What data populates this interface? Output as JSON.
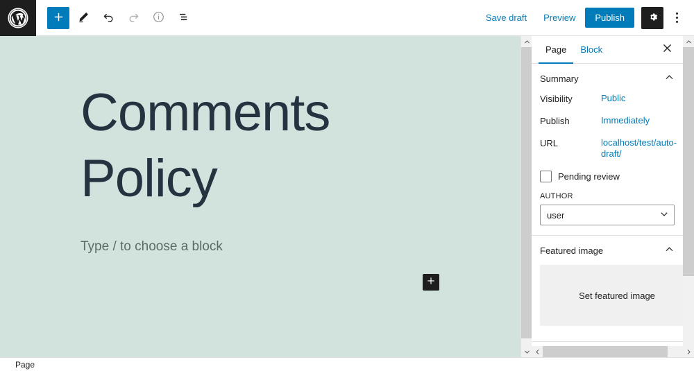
{
  "topbar": {
    "logo_icon": "wordpress-logo-icon",
    "tools": [
      {
        "name": "block-inserter-button",
        "icon": "plus-icon",
        "state": "primary"
      },
      {
        "name": "tools-edit-button",
        "icon": "pencil-icon",
        "state": "default"
      },
      {
        "name": "undo-button",
        "icon": "undo-arrow-icon",
        "state": "default"
      },
      {
        "name": "redo-button",
        "icon": "redo-arrow-icon",
        "state": "disabled"
      },
      {
        "name": "details-button",
        "icon": "info-circle-icon",
        "state": "default"
      },
      {
        "name": "list-view-button",
        "icon": "list-view-icon",
        "state": "default"
      }
    ],
    "save_draft_label": "Save draft",
    "preview_label": "Preview",
    "publish_label": "Publish",
    "settings_icon": "gear-icon",
    "more_options_icon": "kebab-menu-icon"
  },
  "editor": {
    "title": "Comments Policy",
    "placeholder": "Type / to choose a block",
    "inserter_icon": "plus-icon",
    "canvas_bg": "#d2e3dd",
    "title_color": "#253240"
  },
  "sidebar": {
    "tabs": [
      {
        "label": "Page",
        "active": true
      },
      {
        "label": "Block",
        "active": false
      }
    ],
    "close_icon": "close-icon",
    "summary": {
      "title": "Summary",
      "collapse_icon": "chevron-up-icon",
      "rows": [
        {
          "label": "Visibility",
          "value": "Public"
        },
        {
          "label": "Publish",
          "value": "Immediately"
        },
        {
          "label": "URL",
          "value": "localhost/test/auto-draft/"
        }
      ],
      "pending_review_label": "Pending review",
      "pending_review_checked": false,
      "author_field_label": "AUTHOR",
      "author_value": "user",
      "author_chevron_icon": "chevron-down-icon"
    },
    "featured_image": {
      "title": "Featured image",
      "collapse_icon": "chevron-up-icon",
      "set_label": "Set featured image"
    }
  },
  "scrollbars": {
    "outer_vertical": {
      "up_icon": "chevron-up-icon",
      "down_icon": "chevron-down-icon"
    },
    "inner_vertical": {
      "up_icon": "chevron-up-icon",
      "down_icon": "chevron-down-icon"
    },
    "horizontal": {
      "left_icon": "chevron-left-icon",
      "right_icon": "chevron-right-icon"
    }
  },
  "statusbar": {
    "breadcrumb": "Page"
  },
  "colors": {
    "accent": "#007cba",
    "dark": "#1e1e1e",
    "canvas": "#d2e3dd"
  }
}
